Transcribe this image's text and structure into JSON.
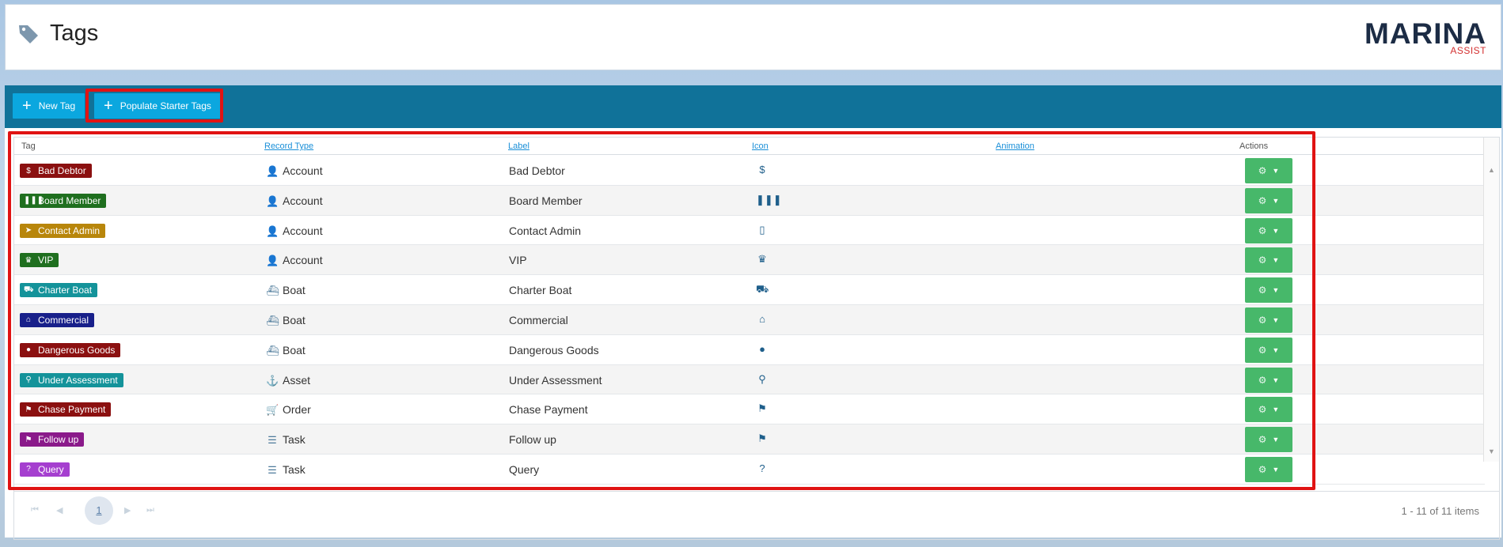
{
  "page": {
    "title": "Tags"
  },
  "logo": {
    "main": "MARINA",
    "sub": "ASSIST"
  },
  "toolbar": {
    "new_tag": "New Tag",
    "populate": "Populate Starter Tags"
  },
  "grid": {
    "columns": {
      "tag": "Tag",
      "record_type": "Record Type",
      "label": "Label",
      "icon": "Icon",
      "animation": "Animation",
      "actions": "Actions"
    },
    "rows": [
      {
        "tag": "Bad Debtor",
        "color": "#8b1010",
        "tag_icon": "hand-coin-icon",
        "record_type": "Account",
        "rt_icon": "person-icon",
        "label": "Bad Debtor",
        "icon": "hand-coin-icon"
      },
      {
        "tag": "Board Member",
        "color": "#1f6f1f",
        "tag_icon": "people-icon",
        "record_type": "Account",
        "rt_icon": "person-icon",
        "label": "Board Member",
        "icon": "people-icon"
      },
      {
        "tag": "Contact Admin",
        "color": "#b8860b",
        "tag_icon": "telegram-icon",
        "record_type": "Account",
        "rt_icon": "person-icon",
        "label": "Contact Admin",
        "icon": "phone-icon"
      },
      {
        "tag": "VIP",
        "color": "#1f6f1f",
        "tag_icon": "crown-icon",
        "record_type": "Account",
        "rt_icon": "person-icon",
        "label": "VIP",
        "icon": "crown-icon"
      },
      {
        "tag": "Charter Boat",
        "color": "#14939a",
        "tag_icon": "truck-icon",
        "record_type": "Boat",
        "rt_icon": "boat-icon",
        "label": "Charter Boat",
        "icon": "truck-icon"
      },
      {
        "tag": "Commercial",
        "color": "#18208a",
        "tag_icon": "warehouse-icon",
        "record_type": "Boat",
        "rt_icon": "boat-icon",
        "label": "Commercial",
        "icon": "warehouse-icon"
      },
      {
        "tag": "Dangerous Goods",
        "color": "#8b1010",
        "tag_icon": "bomb-icon",
        "record_type": "Boat",
        "rt_icon": "boat-icon",
        "label": "Dangerous Goods",
        "icon": "bomb-icon"
      },
      {
        "tag": "Under Assessment",
        "color": "#14939a",
        "tag_icon": "search-icon",
        "record_type": "Asset",
        "rt_icon": "anchor-icon",
        "label": "Under Assessment",
        "icon": "search-icon"
      },
      {
        "tag": "Chase Payment",
        "color": "#8b1010",
        "tag_icon": "running-icon",
        "record_type": "Order",
        "rt_icon": "cart-icon",
        "label": "Chase Payment",
        "icon": "running-icon"
      },
      {
        "tag": "Follow up",
        "color": "#8a1a8a",
        "tag_icon": "running-icon",
        "record_type": "Task",
        "rt_icon": "task-list-icon",
        "label": "Follow up",
        "icon": "running-icon"
      },
      {
        "tag": "Query",
        "color": "#a53fcf",
        "tag_icon": "question-icon",
        "record_type": "Task",
        "rt_icon": "task-list-icon",
        "label": "Query",
        "icon": "question-icon"
      }
    ]
  },
  "pager": {
    "current": "1",
    "info": "1 - 11 of 11 items"
  },
  "colors": {
    "toolbar": "#107299",
    "button": "#0ba7df",
    "action": "#47b86a",
    "highlight": "#e01313"
  }
}
